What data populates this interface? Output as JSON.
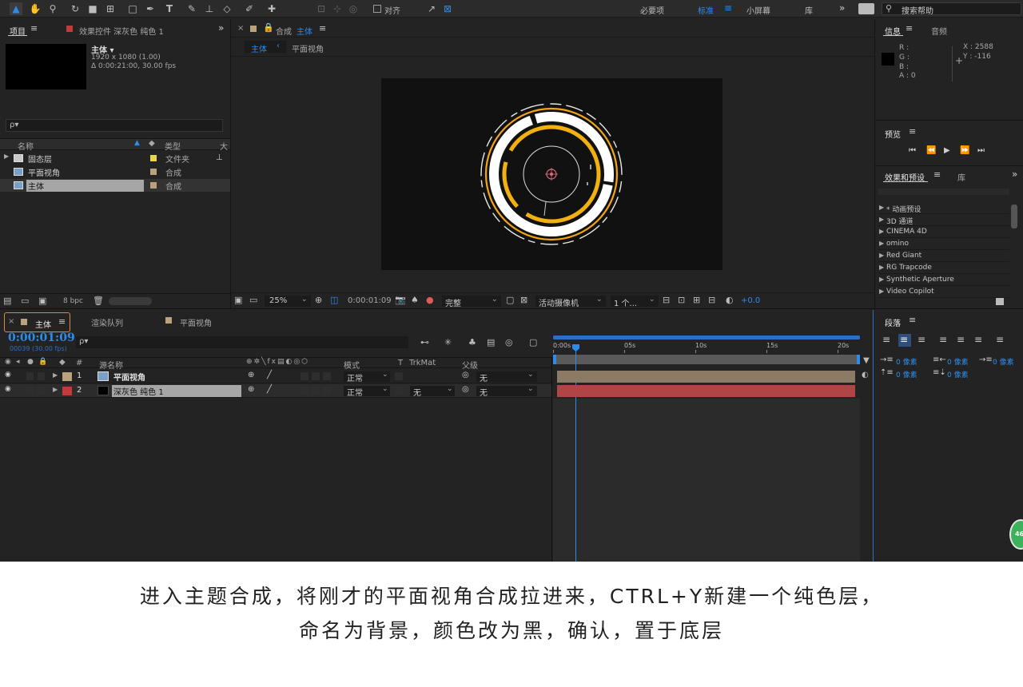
{
  "toolbar": {
    "align_label": "对齐",
    "workspaces": [
      "必要项",
      "标准",
      "小屏幕",
      "库"
    ],
    "active_workspace": "标准",
    "search_placeholder": "搜索帮助"
  },
  "project_panel": {
    "tab_project": "项目",
    "tab_effects": "效果控件 深灰色 纯色 1",
    "comp_name": "主体 ▾",
    "comp_res": "1920 x 1080 (1.00)",
    "comp_dur": "Δ 0:00:21:00, 30.00 fps",
    "search_placeholder": "ρ▾",
    "col_name": "名称",
    "col_type": "类型",
    "col_size": "大",
    "items": [
      {
        "name": "固态层",
        "type": "文件夹",
        "color": "#e8d44d"
      },
      {
        "name": "平面视角",
        "type": "合成",
        "color": "#b9a27c"
      },
      {
        "name": "主体",
        "type": "合成",
        "color": "#b9a27c"
      }
    ],
    "bpc": "8 bpc"
  },
  "comp_viewer": {
    "tab_prefix": "合成",
    "tab_name": "主体",
    "breadcrumb": [
      "主体",
      "平面视角"
    ],
    "zoom": "25%",
    "timecode": "0:00:01:09",
    "resolution": "完整",
    "camera": "活动摄像机",
    "views": "1 个...",
    "exposure": "+0.0"
  },
  "info_panel": {
    "tab_info": "信息",
    "tab_audio": "音频",
    "r": "R :",
    "g": "G :",
    "b": "B :",
    "a": "A : 0",
    "x": "X : 2588",
    "y": "Y : -116"
  },
  "preview_panel": {
    "title": "预览"
  },
  "effects_panel": {
    "tab_effects": "效果和预设",
    "tab_lib": "库",
    "items": [
      "* 动画预设",
      "3D 通道",
      "CINEMA 4D",
      "omino",
      "Red Giant",
      "RG Trapcode",
      "Synthetic Aperture",
      "Video Copilot"
    ]
  },
  "timeline": {
    "tab_main": "主体",
    "tab_render": "渲染队列",
    "tab_flat": "平面视角",
    "timecode": "0:00:01:09",
    "frames": "00039 (30.00 fps)",
    "search_placeholder": "ρ▾",
    "col_num": "#",
    "col_source": "源名称",
    "col_mode": "模式",
    "col_t": "T",
    "col_trkmat": "TrkMat",
    "col_parent": "父级",
    "ruler": [
      "0:00s",
      "05s",
      "10s",
      "15s",
      "20s"
    ],
    "layers": [
      {
        "num": "1",
        "name": "平面视角",
        "mode": "正常",
        "trkmat": "",
        "parent": "无",
        "label_color": "#b9a27c",
        "bar_color": "#8a7a66"
      },
      {
        "num": "2",
        "name": "深灰色 纯色 1",
        "mode": "正常",
        "trkmat": "无",
        "parent": "无",
        "label_color": "#c23a3a",
        "bar_color": "#b04545"
      }
    ]
  },
  "paragraph_panel": {
    "title": "段落",
    "px_labels": [
      "0 像素",
      "0 像素",
      "0 像素",
      "0 像素",
      "0 像素"
    ]
  },
  "badge": "46",
  "caption": {
    "line1": "进入主题合成，将刚才的平面视角合成拉进来，CTRL+Y新建一个纯色层，",
    "line2": "命名为背景，颜色改为黑，确认，置于底层"
  }
}
